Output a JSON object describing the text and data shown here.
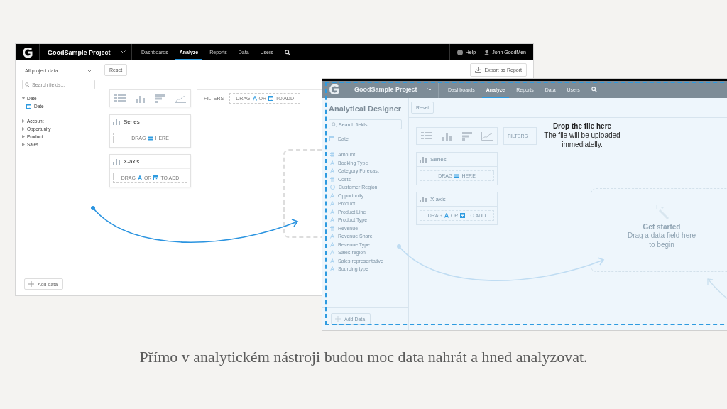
{
  "designer_screenshot": {
    "top_bar": {
      "project": "GoodSample Project",
      "nav": [
        {
          "label": "Dashboards",
          "selected": false
        },
        {
          "label": "Analyze",
          "selected": true
        },
        {
          "label": "Reports",
          "selected": false
        },
        {
          "label": "Data",
          "selected": false
        },
        {
          "label": "Users",
          "selected": false
        }
      ],
      "help": "Help",
      "user": "John GoodMen"
    },
    "sidebar": {
      "dataset": "All project data",
      "search_placeholder": "Search fields...",
      "tree": [
        {
          "label": "Date",
          "expanded": true,
          "children": [
            {
              "label": "Date"
            }
          ]
        },
        {
          "label": "Account",
          "expanded": false
        },
        {
          "label": "Opportunity",
          "expanded": false
        },
        {
          "label": "Product",
          "expanded": false
        },
        {
          "label": "Sales",
          "expanded": false
        }
      ],
      "add_button": "Add data"
    },
    "toolbar": {
      "reset": "Reset",
      "export": "Export as Report"
    },
    "filters": {
      "label": "FILTERS",
      "kind": "attribute",
      "hint": [
        "DRAG",
        "OR",
        "TO ADD"
      ]
    },
    "buckets": [
      {
        "title": "Series",
        "kind": "stack",
        "hint": [
          "DRAG",
          "HERE"
        ]
      },
      {
        "title": "X-axis",
        "kind": "attribute",
        "hint": [
          "DRAG",
          "OR",
          "TO ADD"
        ]
      }
    ]
  },
  "upload_screenshot": {
    "top_bar": {
      "project": "GoodSample Project",
      "nav": [
        {
          "label": "Dashboards",
          "selected": false
        },
        {
          "label": "Analyze",
          "selected": true
        },
        {
          "label": "Reports",
          "selected": false
        },
        {
          "label": "Data",
          "selected": false
        },
        {
          "label": "Users",
          "selected": false
        }
      ]
    },
    "title": "Analytical Designer",
    "reset": "Reset",
    "search_placeholder": "Search fields...",
    "date_item": "Date",
    "fields": [
      {
        "label": "Amount",
        "kind": "metric"
      },
      {
        "label": "Booking Type",
        "kind": "attribute"
      },
      {
        "label": "Category Forecast",
        "kind": "attribute"
      },
      {
        "label": "Costs",
        "kind": "metric"
      },
      {
        "label": "Customer Region",
        "kind": "geo"
      },
      {
        "label": "Opportunity",
        "kind": "attribute"
      },
      {
        "label": "Product",
        "kind": "attribute"
      },
      {
        "label": "Product Line",
        "kind": "attribute"
      },
      {
        "label": "Product Type",
        "kind": "attribute"
      },
      {
        "label": "Revenue",
        "kind": "metric"
      },
      {
        "label": "Revenue Share",
        "kind": "attribute"
      },
      {
        "label": "Revenue Type",
        "kind": "attribute"
      },
      {
        "label": "Sales region",
        "kind": "attribute"
      },
      {
        "label": "Sales representative",
        "kind": "attribute"
      },
      {
        "label": "Sourcing type",
        "kind": "attribute"
      }
    ],
    "add_button": "Add Data",
    "filters": {
      "label": "FILTERS"
    },
    "buckets": [
      {
        "title": "Series",
        "kind": "stack",
        "hint": [
          "DRAG",
          "HERE"
        ]
      },
      {
        "title": "X axis",
        "kind": "attribute",
        "hint": [
          "DRAG",
          "OR",
          "TO ADD"
        ]
      }
    ],
    "empty_state": {
      "title": "Get started",
      "text": "Drag a data field here to begin"
    },
    "drop_message": {
      "title": "Drop the file here",
      "text": "The file will be uploaded immediatelly."
    }
  },
  "caption": "Přímo v analytickém nástroji budou moc data nahrát a hned analyzovat."
}
